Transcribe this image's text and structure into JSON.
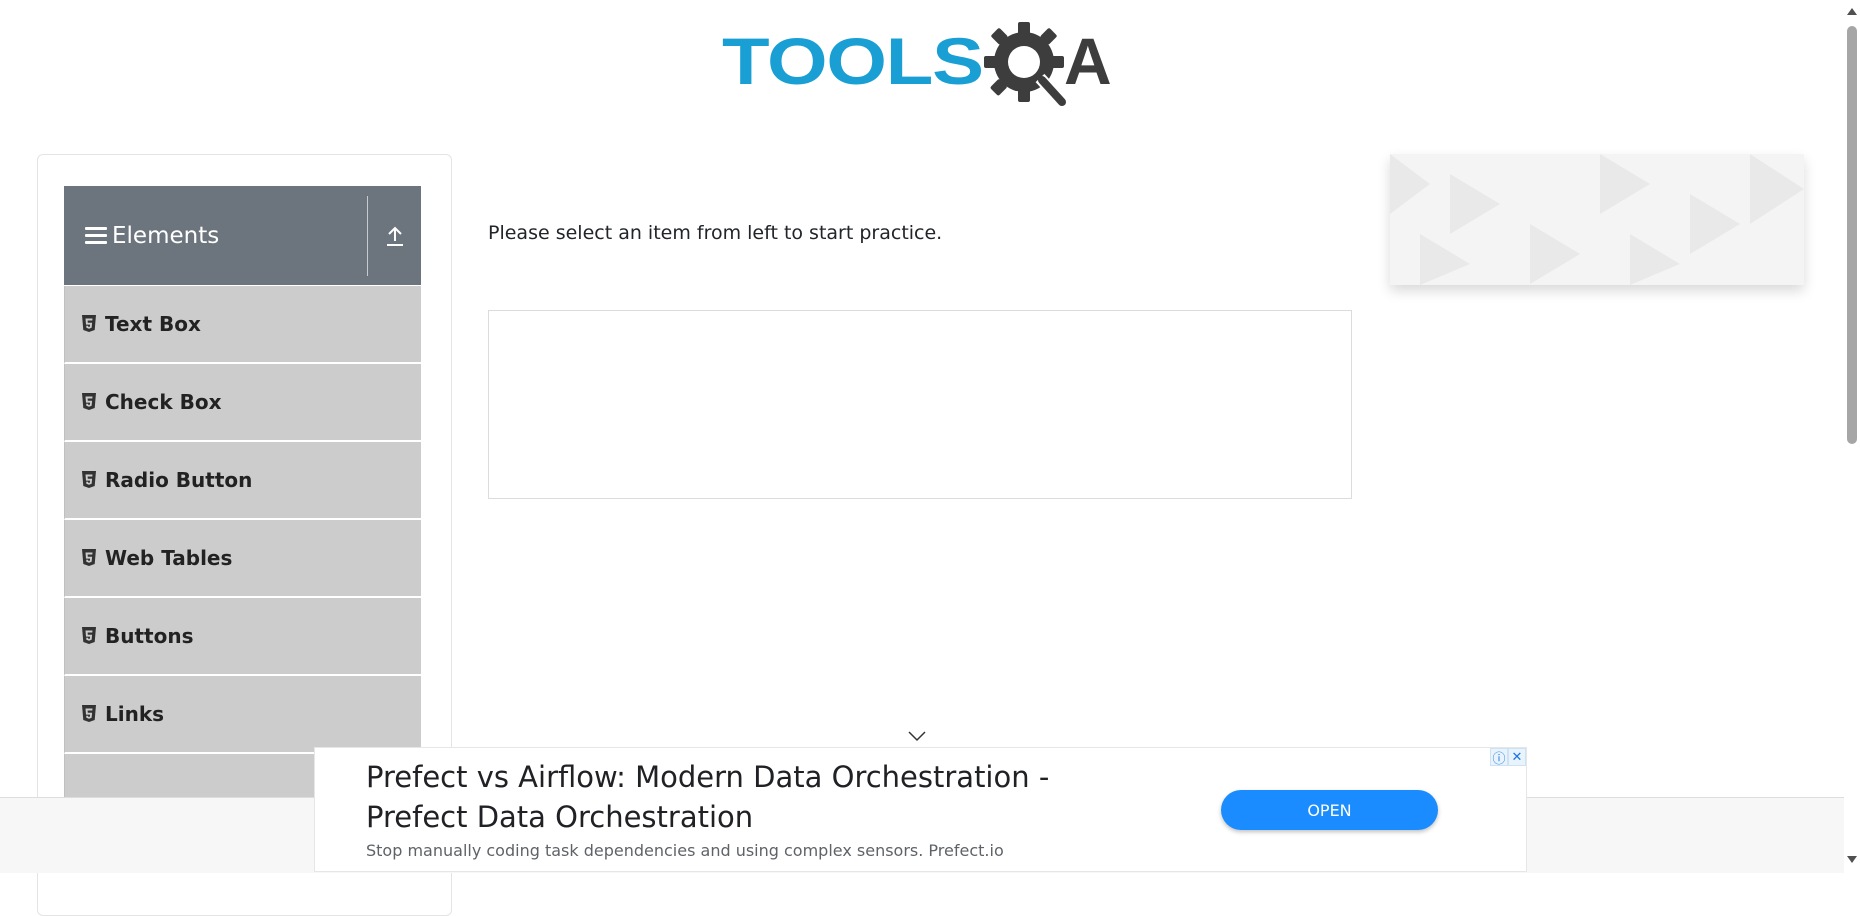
{
  "header": {
    "logo_text": "TOOLS",
    "logo_text_suffix": "A",
    "logo_icon": "gear-magnifier-icon",
    "brand_colors": {
      "blue": "#1a9fd4",
      "dark": "#3d3d3d"
    }
  },
  "sidebar": {
    "group_title": "Elements",
    "group_icon": "hamburger-icon",
    "collapse_icon": "upload-arrow-icon",
    "items": [
      {
        "label": "Text Box",
        "icon": "html5-icon"
      },
      {
        "label": "Check Box",
        "icon": "html5-icon"
      },
      {
        "label": "Radio Button",
        "icon": "html5-icon"
      },
      {
        "label": "Web Tables",
        "icon": "html5-icon"
      },
      {
        "label": "Buttons",
        "icon": "html5-icon"
      },
      {
        "label": "Links",
        "icon": "html5-icon"
      }
    ]
  },
  "main": {
    "intro_text": "Please select an item from left to start practice."
  },
  "ad": {
    "title": "Prefect vs Airflow: Modern Data Orchestration - Prefect Data Orchestration",
    "description": "Stop manually coding task dependencies and using complex sensors. Prefect.io",
    "button_label": "OPEN",
    "info_icon": "info-icon",
    "close_icon": "close-icon",
    "accent_color": "#1a8cff"
  }
}
